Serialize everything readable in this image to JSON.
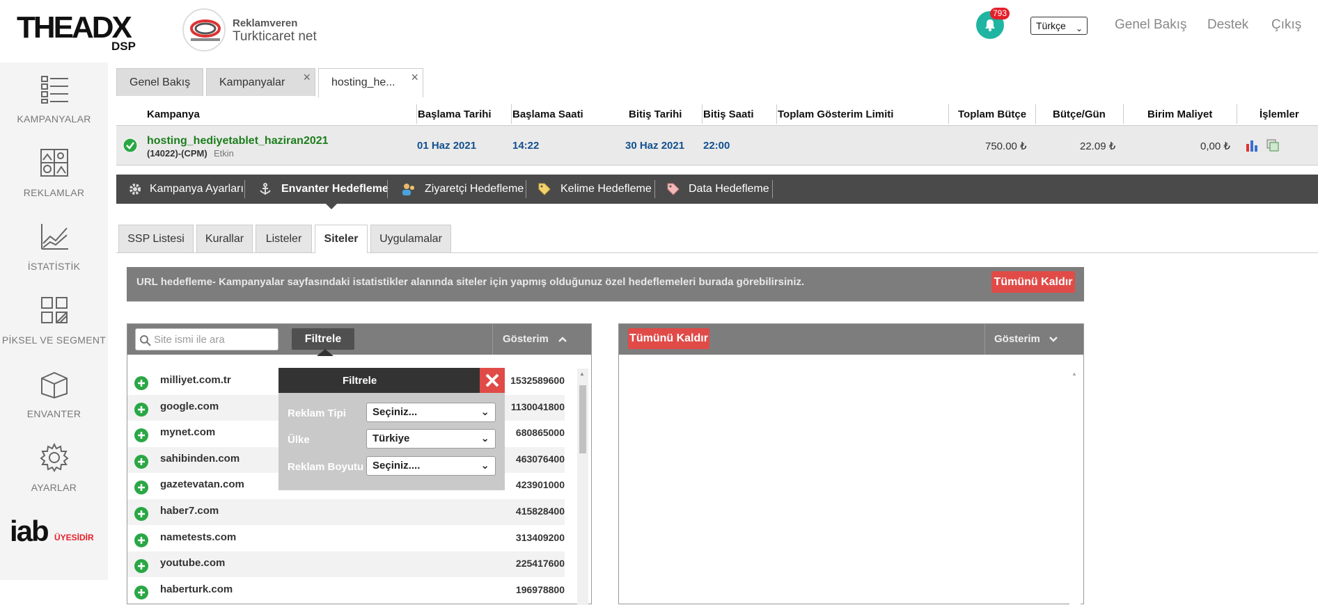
{
  "header": {
    "logo_text": "THEADX",
    "logo_sub": "DSP",
    "advertiser_label": "Reklamveren",
    "advertiser_name": "Turkticaret net",
    "notification_count": "793",
    "language": "Türkçe",
    "links": [
      "Genel Bakış",
      "Destek",
      "Çıkış"
    ]
  },
  "sidebar": {
    "items": [
      "KAMPANYALAR",
      "REKLAMLAR",
      "İSTATİSTİK",
      "PİKSEL VE SEGMENT",
      "ENVANTER",
      "AYARLAR"
    ],
    "iab_text": "iab",
    "iab_sub": "ÜYESİDİR"
  },
  "page_tabs": [
    {
      "label": "Genel Bakış"
    },
    {
      "label": "Kampanyalar"
    },
    {
      "label": "hosting_he..."
    }
  ],
  "campaign_table": {
    "headers": [
      "Kampanya",
      "Başlama Tarihi",
      "Başlama Saati",
      "Bitiş Tarihi",
      "Bitiş Saati",
      "Toplam Gösterim Limiti",
      "Toplam Bütçe",
      "Bütçe/Gün",
      "Birim Maliyet",
      "İşlemler"
    ],
    "row": {
      "name": "hosting_hediyetablet_haziran2021",
      "meta": "(14022)-(CPM)",
      "status": "Etkin",
      "start_date": "01 Haz 2021",
      "start_time": "14:22",
      "end_date": "30 Haz 2021",
      "end_time": "22:00",
      "total_budget": "750.00 ₺",
      "daily_budget": "22.09 ₺",
      "unit_cost": "0,00 ₺"
    }
  },
  "nav": [
    "Kampanya Ayarları",
    "Envanter Hedefleme",
    "Ziyaretçi Hedefleme",
    "Kelime Hedefleme",
    "Data Hedefleme"
  ],
  "sub_tabs": [
    "SSP Listesi",
    "Kurallar",
    "Listeler",
    "Siteler",
    "Uygulamalar"
  ],
  "info": {
    "text": "URL hedefleme- Kampanyalar sayfasındaki istatistikler alanında siteler için yapmış olduğunuz özel hedeflemeleri burada görebilirsiniz.",
    "remove_all": "Tümünü Kaldır"
  },
  "left_panel": {
    "search_placeholder": "Site ismi ile ara",
    "filter_button": "Filtrele",
    "col_label": "Gösterim",
    "sites": [
      {
        "name": "milliyet.com.tr",
        "value": "1532589600"
      },
      {
        "name": "google.com",
        "value": "1130041800"
      },
      {
        "name": "mynet.com",
        "value": "680865000"
      },
      {
        "name": "sahibinden.com",
        "value": "463076400"
      },
      {
        "name": "gazetevatan.com",
        "value": "423901000"
      },
      {
        "name": "haber7.com",
        "value": "415828400"
      },
      {
        "name": "nametests.com",
        "value": "313409200"
      },
      {
        "name": "youtube.com",
        "value": "225417600"
      },
      {
        "name": "haberturk.com",
        "value": "196978800"
      }
    ]
  },
  "right_panel": {
    "remove_all": "Tümünü Kaldır",
    "col_label": "Gösterim"
  },
  "filter_popup": {
    "title": "Filtrele",
    "fields": [
      {
        "label": "Reklam Tipi",
        "value": "Seçiniz..."
      },
      {
        "label": "Ülke",
        "value": "Türkiye"
      },
      {
        "label": "Reklam Boyutu",
        "value": "Seçiniz...."
      }
    ]
  },
  "colors": {
    "accent_green": "#2aa745",
    "danger_red": "#e04b48",
    "link_blue": "#12508e",
    "teal": "#1fb5a2"
  }
}
